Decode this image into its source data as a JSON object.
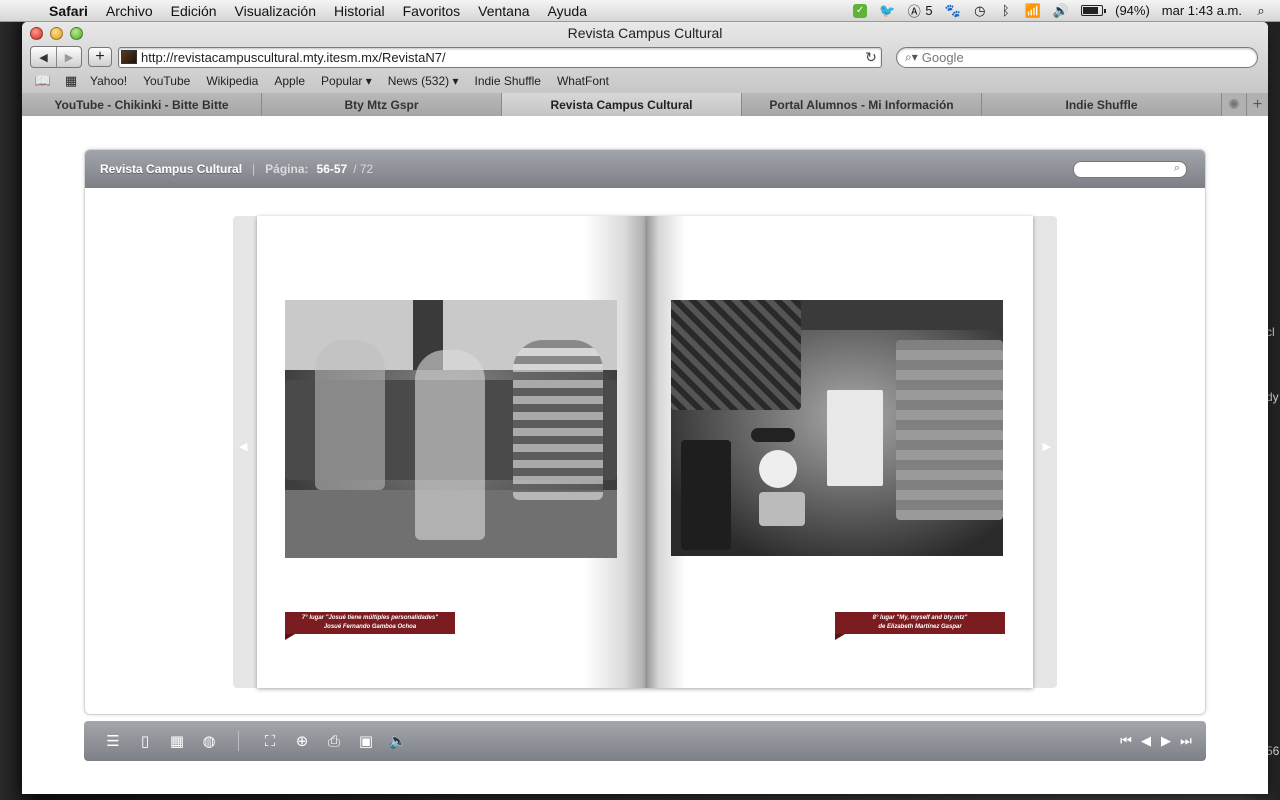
{
  "menubar": {
    "apple_glyph": "",
    "items": [
      "Safari",
      "Archivo",
      "Edición",
      "Visualización",
      "Historial",
      "Favoritos",
      "Ventana",
      "Ayuda"
    ],
    "extras": {
      "adobe_count": "5",
      "battery": "(94%)",
      "clock": "mar 1:43 a.m."
    }
  },
  "window": {
    "title": "Revista Campus Cultural",
    "url": "http://revistacampuscultural.mty.itesm.mx/RevistaN7/",
    "search_placeholder": "Google",
    "bookmarks": [
      "Yahoo!",
      "YouTube",
      "Wikipedia",
      "Apple",
      "Popular ▾",
      "News (532) ▾",
      "Indie Shuffle",
      "WhatFont"
    ],
    "tabs": [
      {
        "label": "YouTube - Chikinki - Bitte Bitte",
        "active": false
      },
      {
        "label": "Bty Mtz Gspr",
        "active": false
      },
      {
        "label": "Revista Campus Cultural",
        "active": true
      },
      {
        "label": "Portal Alumnos - Mi Información",
        "active": false
      },
      {
        "label": "Indie Shuffle",
        "active": false
      }
    ]
  },
  "viewer": {
    "title": "Revista Campus Cultural",
    "page_label": "Página:",
    "page_range": "56-57",
    "page_total": "/ 72",
    "left_caption_line1": "7° lugar \"Josué tiene múltiples personalidades\"",
    "left_caption_line2": "Josué Fernando Gamboa Ochoa",
    "right_caption_line1": "8° lugar \"My, myself and bty.mtz\"",
    "right_caption_line2": "de Elizabeth Martínez Gaspar"
  },
  "colors": {
    "caption_bg": "#7b1c21",
    "viewer_bar": "#8e9297"
  }
}
